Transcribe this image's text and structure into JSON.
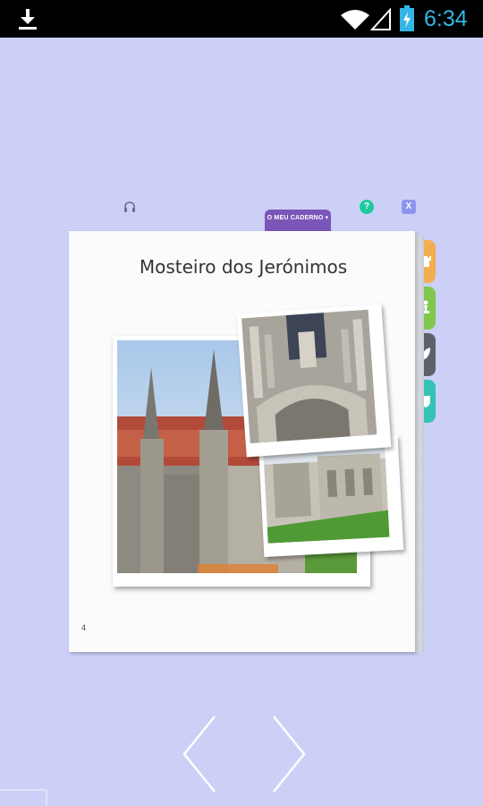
{
  "status_bar": {
    "time": "6:34",
    "icons": [
      "download-icon",
      "wifi-icon",
      "signal-icon",
      "battery-icon"
    ]
  },
  "toolbar": {
    "notebook_tab_label": "O MEU CADERNO ▾",
    "help_label": "?",
    "close_label": "X"
  },
  "page": {
    "title": "Mosteiro dos Jerónimos",
    "number": "4"
  },
  "side_tabs": [
    {
      "icon": "castle-icon",
      "color": "#f4ae52"
    },
    {
      "icon": "chess-piece-icon",
      "color": "#7fc84a"
    },
    {
      "icon": "feather-icon",
      "color": "#5d6169"
    },
    {
      "icon": "shield-icon",
      "color": "#36c3b4"
    }
  ],
  "colors": {
    "background": "#ccd0f7",
    "accent_purple": "#7b56b8",
    "clock_blue": "#33b5e5"
  }
}
